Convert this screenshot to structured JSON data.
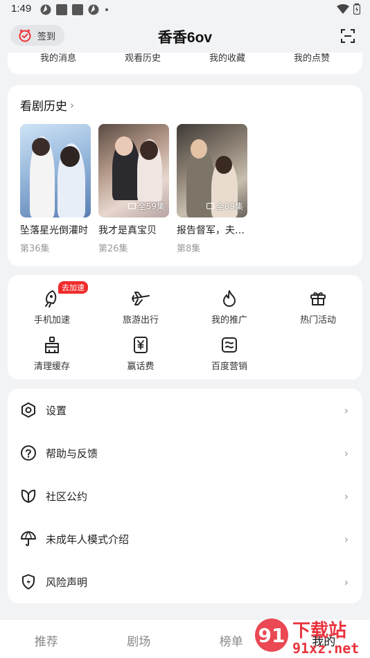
{
  "status": {
    "time": "1:49"
  },
  "header": {
    "checkin_label": "签到",
    "title": "香香6ov"
  },
  "top_links": [
    "我的消息",
    "观看历史",
    "我的收藏",
    "我的点赞"
  ],
  "history": {
    "title": "看剧历史",
    "items": [
      {
        "name": "坠落星光倒灌时",
        "progress": "第36集",
        "badge": ""
      },
      {
        "name": "我才是真宝贝",
        "progress": "第26集",
        "badge": "全59集"
      },
      {
        "name": "报告督军，夫…",
        "progress": "第8集",
        "badge": "全89集"
      }
    ]
  },
  "tools": [
    {
      "label": "手机加速",
      "icon": "rocket-icon",
      "badge": "去加速"
    },
    {
      "label": "旅游出行",
      "icon": "airplane-icon"
    },
    {
      "label": "我的推广",
      "icon": "flame-icon"
    },
    {
      "label": "热门活动",
      "icon": "gift-icon"
    },
    {
      "label": "清理缓存",
      "icon": "broom-icon"
    },
    {
      "label": "赢话费",
      "icon": "yuan-icon"
    },
    {
      "label": "百度营销",
      "icon": "marketing-icon"
    }
  ],
  "menu": [
    {
      "label": "设置",
      "icon": "settings-icon"
    },
    {
      "label": "帮助与反馈",
      "icon": "help-icon"
    },
    {
      "label": "社区公约",
      "icon": "leaf-icon"
    },
    {
      "label": "未成年人模式介绍",
      "icon": "umbrella-icon"
    },
    {
      "label": "风险声明",
      "icon": "shield-icon"
    }
  ],
  "tabbar": {
    "tabs": [
      "推荐",
      "剧场",
      "榜单",
      "我的"
    ],
    "active": "我的"
  },
  "watermark": {
    "text": "下载站",
    "domain": "91xz.net",
    "color": "#e8343f"
  }
}
